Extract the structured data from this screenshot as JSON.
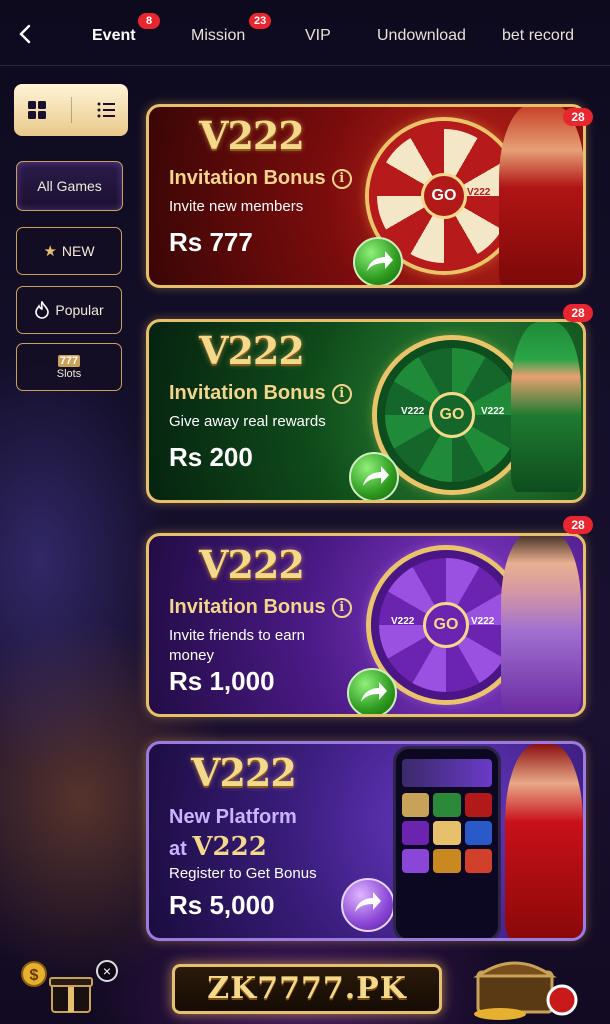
{
  "header": {
    "back_label": "back",
    "tabs": [
      {
        "label": "Event",
        "badge": "8"
      },
      {
        "label": "Mission",
        "badge": "23"
      },
      {
        "label": "VIP"
      },
      {
        "label": "Undownload"
      },
      {
        "label": "bet record"
      }
    ]
  },
  "sidebar": {
    "items": [
      {
        "label": "All Games"
      },
      {
        "label": "NEW"
      },
      {
        "label": "Popular"
      },
      {
        "label": "Slots",
        "logo_text": "777"
      }
    ]
  },
  "cards": [
    {
      "logo": "V222",
      "title": "Invitation Bonus",
      "subtitle": "Invite new members",
      "amount": "Rs 777",
      "count": "28",
      "wheel_center": "GO",
      "wheel_label": "V222",
      "theme": "#7a0c0c"
    },
    {
      "logo": "V222",
      "title": "Invitation Bonus",
      "subtitle": "Give away real rewards",
      "amount": "Rs 200",
      "count": "28",
      "wheel_center": "GO",
      "wheel_label": "V222",
      "theme": "#0f4a1a"
    },
    {
      "logo": "V222",
      "title": "Invitation Bonus",
      "subtitle": "Invite friends to earn money",
      "amount": "Rs 1,000",
      "count": "28",
      "wheel_center": "GO",
      "wheel_label": "V222",
      "theme": "#4a1a85"
    },
    {
      "logo": "V222",
      "title_line1": "New Platform",
      "title_line2_prefix": "at",
      "title_line2_brand": "V222",
      "subtitle": "Register to Get Bonus",
      "amount": "Rs 5,000",
      "theme": "#3a1d7c"
    }
  ],
  "footer": {
    "brand": "ZK7777.PK",
    "close_label": "×"
  },
  "colors": {
    "gold": "#e6c06a",
    "badge_red": "#e8262f",
    "text_gold": "#f3d58b"
  }
}
